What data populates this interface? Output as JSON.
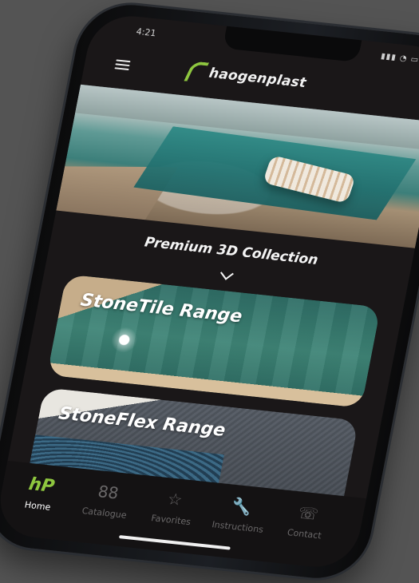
{
  "status": {
    "time": "4:21",
    "icons": "▮▮▮ ◔ ▭"
  },
  "header": {
    "logo_text": "haogenplast",
    "brand_color": "#8ec63f"
  },
  "main": {
    "section_title": "Premium 3D Collection",
    "cards": [
      {
        "label": "StoneTile Range"
      },
      {
        "label": "StoneFlex Range"
      }
    ]
  },
  "tabbar": {
    "items": [
      {
        "label": "Home",
        "icon": "hp-logo-icon",
        "glyph": "hP",
        "active": true
      },
      {
        "label": "Catalogue",
        "icon": "grid-icon",
        "glyph": "88",
        "active": false
      },
      {
        "label": "Favorites",
        "icon": "star-icon",
        "glyph": "☆",
        "active": false
      },
      {
        "label": "Instructions",
        "icon": "wrench-icon",
        "glyph": "🔧",
        "active": false
      },
      {
        "label": "Contact",
        "icon": "phone-icon",
        "glyph": "☏",
        "active": false
      }
    ]
  }
}
